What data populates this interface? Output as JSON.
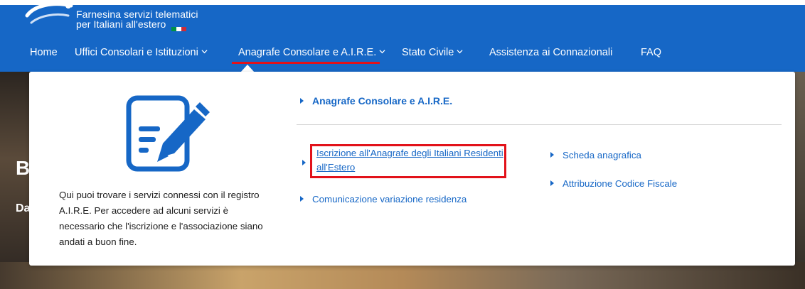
{
  "brand": {
    "line1": "Farnesina servizi telematici",
    "line2": "per Italiani all'estero",
    "flag_colors": [
      "#009246",
      "#ffffff",
      "#ce2b37"
    ]
  },
  "nav": {
    "items": [
      {
        "label": "Home",
        "has_dropdown": false
      },
      {
        "label": "Uffici Consolari e Istituzioni",
        "has_dropdown": true
      },
      {
        "label": "Anagrafe Consolare e A.I.R.E.",
        "has_dropdown": true,
        "active": true
      },
      {
        "label": "Stato Civile",
        "has_dropdown": true
      },
      {
        "label": "Assistenza ai Connazionali",
        "has_dropdown": false
      },
      {
        "label": "FAQ",
        "has_dropdown": false
      }
    ]
  },
  "hero": {
    "heading_fragment": "B",
    "sub_fragment": "Da"
  },
  "dropdown": {
    "icon": "document-edit-icon",
    "description": "Qui puoi trovare i servizi connessi con il registro A.I.R.E. Per accedere ad alcuni servizi è necessario che l'iscrizione e l'associazione siano andati a buon fine.",
    "section_title": "Anagrafe Consolare e A.I.R.E.",
    "links": {
      "iscrizione": "Iscrizione all'Anagrafe degli Italiani Residenti all'Estero",
      "comunicazione": "Comunicazione variazione residenza",
      "scheda": "Scheda anagrafica",
      "codice_fiscale": "Attribuzione Codice Fiscale"
    }
  },
  "colors": {
    "primary": "#1667c6",
    "highlight": "#e2121a"
  }
}
